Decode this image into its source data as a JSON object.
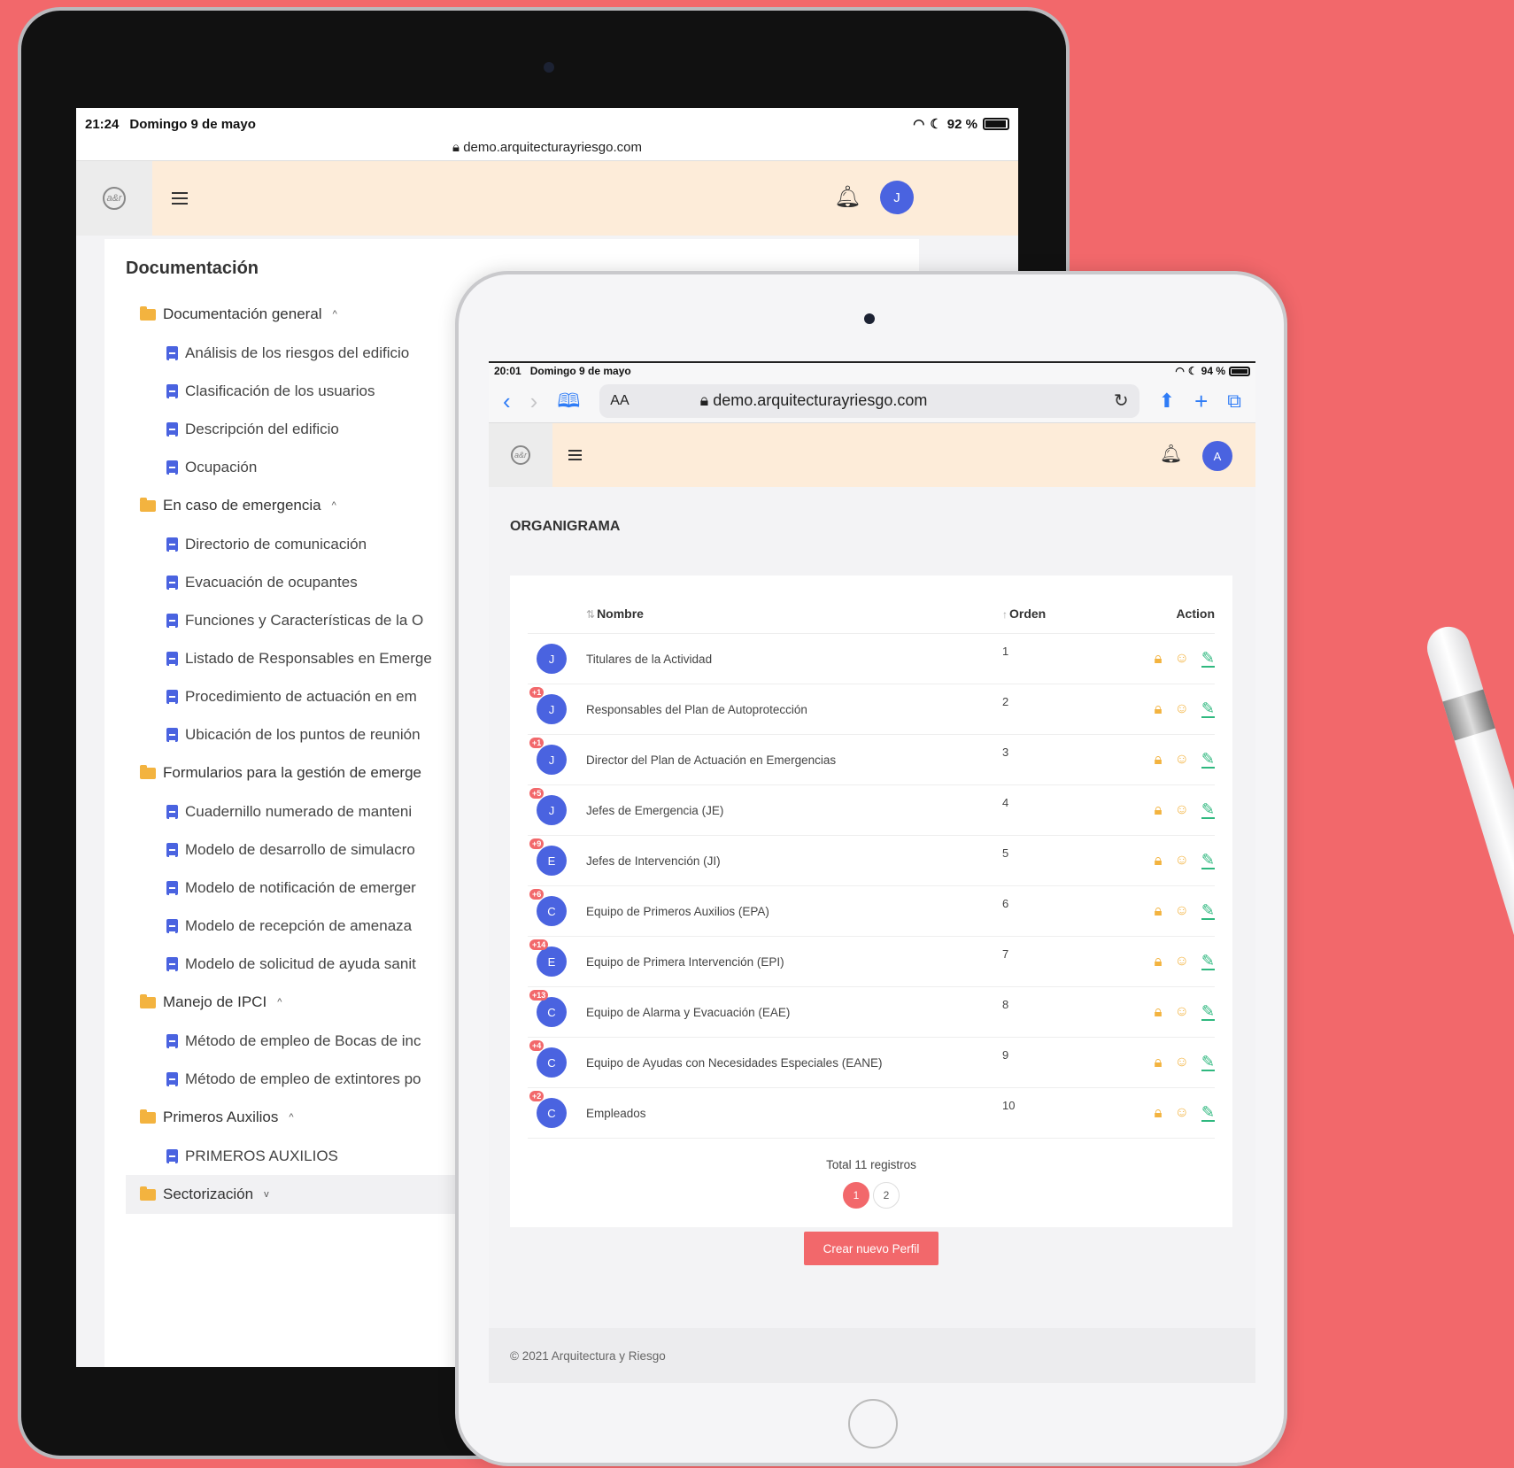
{
  "back_device": {
    "status": {
      "time": "21:24",
      "date": "Domingo 9 de mayo",
      "battery": "92 %"
    },
    "url": "demo.arquitecturayriesgo.com",
    "avatar_initial": "J",
    "logo_text": "a&r",
    "doc_title": "Documentación",
    "sections": [
      {
        "label": "Documentación general",
        "caret": "^",
        "items": [
          "Análisis de los riesgos del edificio",
          "Clasificación de los usuarios",
          "Descripción del edificio",
          "Ocupación"
        ]
      },
      {
        "label": "En caso de emergencia",
        "caret": "^",
        "items": [
          "Directorio de comunicación",
          "Evacuación de ocupantes",
          "Funciones y Características de la O",
          "Listado de Responsables en Emerge",
          "Procedimiento de actuación en em",
          "Ubicación de los puntos de reunión"
        ]
      },
      {
        "label": "Formularios para la gestión de emerge",
        "caret": "",
        "items": [
          "Cuadernillo numerado de manteni",
          "Modelo de desarrollo de simulacro",
          "Modelo de notificación de emerger",
          "Modelo de recepción de amenaza",
          "Modelo de solicitud de ayuda sanit"
        ]
      },
      {
        "label": "Manejo de IPCI",
        "caret": "^",
        "items": [
          "Método de empleo de Bocas de inc",
          "Método de empleo de extintores po"
        ]
      },
      {
        "label": "Primeros Auxilios",
        "caret": "^",
        "items": [
          "PRIMEROS AUXILIOS"
        ]
      },
      {
        "label": "Sectorización",
        "caret": "v",
        "items": []
      }
    ]
  },
  "front_device": {
    "status": {
      "time": "20:01",
      "date": "Domingo 9 de mayo",
      "battery": "94 %"
    },
    "toolbar": {
      "aa": "AA",
      "url": "demo.arquitecturayriesgo.com"
    },
    "avatar_initial": "A",
    "logo_text": "a&r",
    "page_title": "ORGANIGRAMA",
    "table": {
      "headers": {
        "name": "Nombre",
        "order": "Orden",
        "action": "Action"
      },
      "rows": [
        {
          "initial": "J",
          "badge": "",
          "name": "Titulares de la Actividad",
          "order": "1"
        },
        {
          "initial": "J",
          "badge": "+1",
          "name": "Responsables del Plan de Autoprotección",
          "order": "2"
        },
        {
          "initial": "J",
          "badge": "+1",
          "name": "Director del Plan de Actuación en Emergencias",
          "order": "3"
        },
        {
          "initial": "J",
          "badge": "+5",
          "name": "Jefes de Emergencia (JE)",
          "order": "4"
        },
        {
          "initial": "E",
          "badge": "+9",
          "name": "Jefes de Intervención (JI)",
          "order": "5"
        },
        {
          "initial": "C",
          "badge": "+6",
          "name": "Equipo de Primeros Auxilios (EPA)",
          "order": "6"
        },
        {
          "initial": "E",
          "badge": "+14",
          "name": "Equipo de Primera Intervención (EPI)",
          "order": "7"
        },
        {
          "initial": "C",
          "badge": "+13",
          "name": "Equipo de Alarma y Evacuación (EAE)",
          "order": "8"
        },
        {
          "initial": "C",
          "badge": "+4",
          "name": "Equipo de Ayudas con Necesidades Especiales (EANE)",
          "order": "9"
        },
        {
          "initial": "C",
          "badge": "+2",
          "name": "Empleados",
          "order": "10"
        }
      ]
    },
    "total": "Total 11 registros",
    "pages": [
      "1",
      "2"
    ],
    "create_button": "Crear nuevo Perfil",
    "footer": "© 2021 Arquitectura y Riesgo"
  },
  "colors": {
    "accent": "#f2686b",
    "avatar": "#4a63e0",
    "header_bg": "#fdecd9",
    "folder": "#f3b33f",
    "edit": "#2fb87f"
  }
}
